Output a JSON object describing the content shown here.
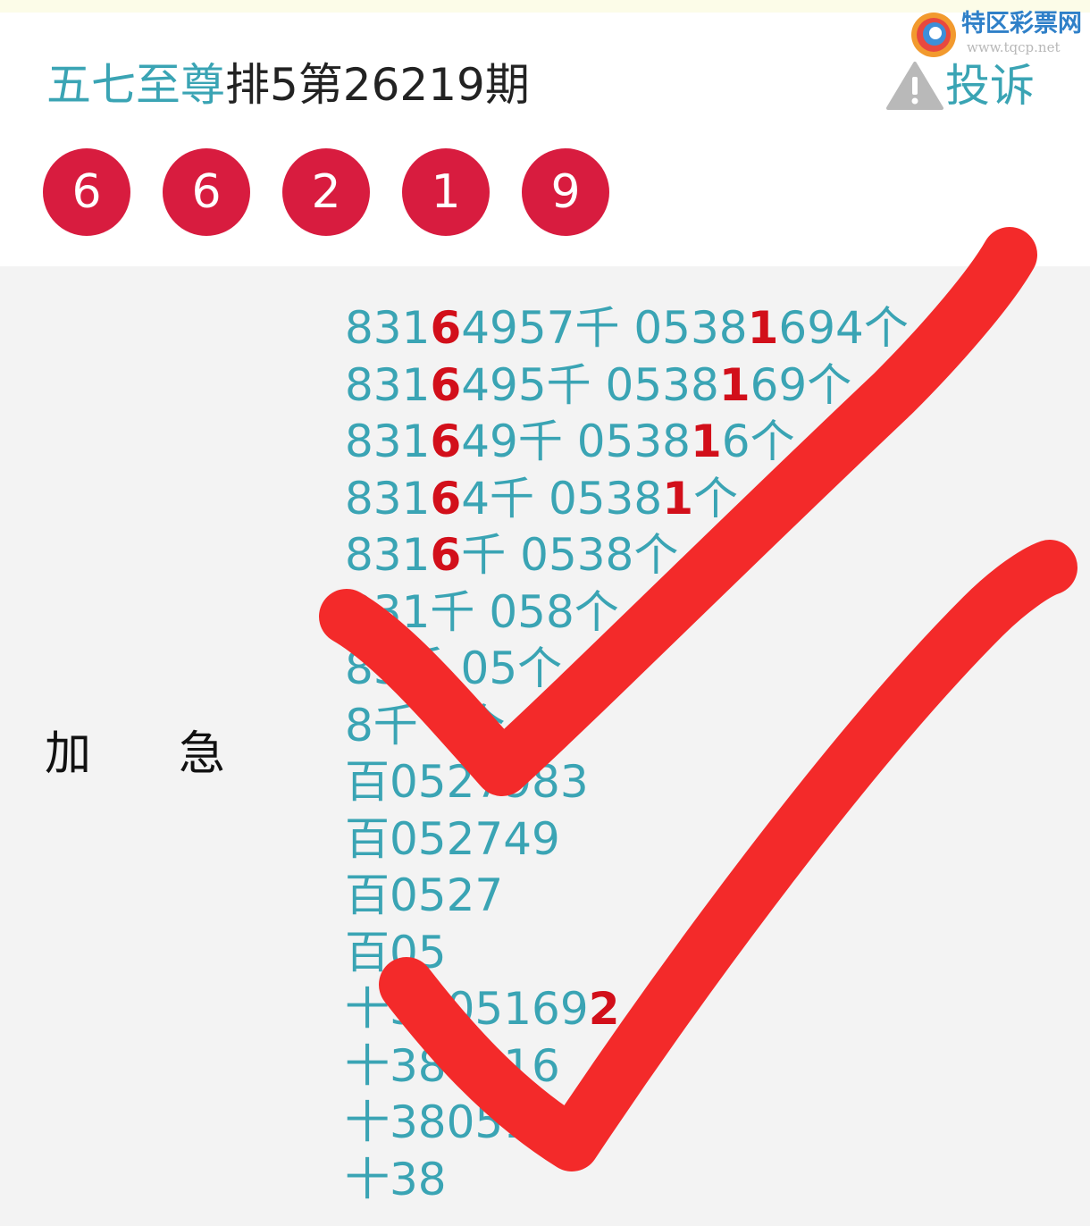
{
  "header": {
    "author": "五七至尊",
    "issue": "排5第26219期",
    "complain_label": "投诉"
  },
  "watermark": {
    "name": "特区彩票网",
    "url": "www.tqcp.net"
  },
  "result_numbers": [
    "6",
    "6",
    "2",
    "1",
    "9"
  ],
  "left_labels": [
    "加",
    "急"
  ],
  "prediction_lines": [
    [
      [
        "831",
        false
      ],
      [
        "6",
        true
      ],
      [
        "4957千 0538",
        false
      ],
      [
        "1",
        true
      ],
      [
        "694个",
        false
      ]
    ],
    [
      [
        "831",
        false
      ],
      [
        "6",
        true
      ],
      [
        "495千 0538",
        false
      ],
      [
        "1",
        true
      ],
      [
        "69个",
        false
      ]
    ],
    [
      [
        "831",
        false
      ],
      [
        "6",
        true
      ],
      [
        "49千 0538",
        false
      ],
      [
        "1",
        true
      ],
      [
        "6个",
        false
      ]
    ],
    [
      [
        "831",
        false
      ],
      [
        "6",
        true
      ],
      [
        "4千 0538",
        false
      ],
      [
        "1",
        true
      ],
      [
        "个",
        false
      ]
    ],
    [
      [
        "831",
        false
      ],
      [
        "6",
        true
      ],
      [
        "千 0538个",
        false
      ]
    ],
    [
      [
        "831千 058个",
        false
      ]
    ],
    [
      [
        "83千 05个",
        false
      ]
    ],
    [
      [
        "8千 0个",
        false
      ]
    ],
    [
      [
        "百0527983",
        false
      ]
    ],
    [
      [
        "百052749",
        false
      ]
    ],
    [
      [
        "百0527",
        false
      ]
    ],
    [
      [
        "百05",
        false
      ]
    ],
    [
      [
        "十3805169",
        false
      ],
      [
        "2",
        true
      ]
    ],
    [
      [
        "十380516",
        false
      ]
    ],
    [
      [
        "十38051",
        false
      ]
    ],
    [
      [
        "十38",
        false
      ]
    ]
  ],
  "colors": {
    "ball": "#d81c3f",
    "text_teal": "#3aa4b4",
    "highlight": "#d20f1a",
    "check_mark": "#f32a2a"
  }
}
